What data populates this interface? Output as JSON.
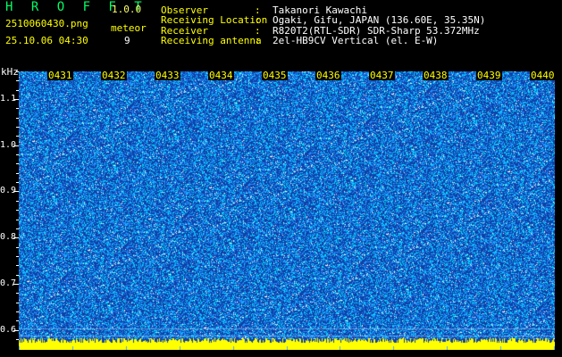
{
  "header": {
    "app_title": "H R O F F T",
    "app_version": "1.0.0",
    "filename": "2510060430.png",
    "datetime": "25.10.06 04:30",
    "type_label": "meteor",
    "count": "9"
  },
  "info": [
    {
      "label": "Observer",
      "sep": ":",
      "value": "Takanori Kawachi"
    },
    {
      "label": "Receiving Location",
      "sep": ":",
      "value": "Ogaki, Gifu, JAPAN (136.60E, 35.35N)"
    },
    {
      "label": "Receiver",
      "sep": ":",
      "value": "R820T2(RTL-SDR) SDR-Sharp 53.372MHz"
    },
    {
      "label": "Receiving antenna",
      "sep": ":",
      "value": "2el-HB9CV Vertical (el. E-W)"
    }
  ],
  "spectrogram": {
    "y_unit": "kHz",
    "y_ticks": [
      "1.1",
      "1.0",
      "0.9",
      "0.8",
      "0.7",
      "0.6"
    ],
    "y_tick_values": [
      1.1,
      1.0,
      0.9,
      0.8,
      0.7,
      0.6
    ],
    "y_range": [
      0.58,
      1.16
    ],
    "minute_labels": [
      "0431",
      "0432",
      "0433",
      "0434",
      "0435",
      "0436",
      "0437",
      "0438",
      "0439",
      "0440"
    ],
    "colors": {
      "background": "#1040a8",
      "noise_mid": "#1e90ff",
      "noise_high": "#00e5ff",
      "noise_peak": "#ffffff",
      "baseline": "#ffff00"
    }
  }
}
